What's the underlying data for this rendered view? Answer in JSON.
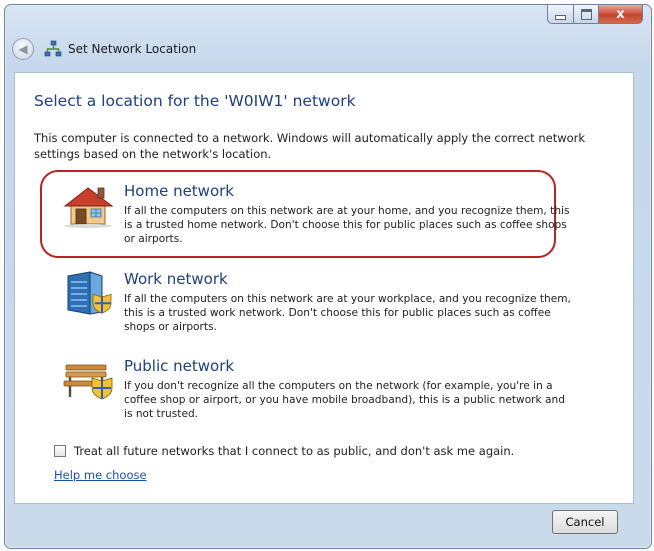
{
  "window": {
    "title": "Set Network Location",
    "close_glyph": "x"
  },
  "main": {
    "heading": "Select a location for the 'W0IW1' network",
    "intro": "This computer is connected to a network. Windows will automatically apply the correct network settings based on the network's location.",
    "options": [
      {
        "title": "Home network",
        "description": "If all the computers on this network are at your home, and you recognize them, this is a trusted home network. Don't choose this for public places such as coffee shops or airports.",
        "icon": "house-icon",
        "highlighted": true
      },
      {
        "title": "Work network",
        "description": "If all the computers on this network are at your workplace, and you recognize them, this is a trusted work network. Don't choose this for public places such as coffee shops or airports.",
        "icon": "office-building-icon",
        "highlighted": false
      },
      {
        "title": "Public network",
        "description": "If you don't recognize all the computers on the network (for example, you're in a coffee shop or airport, or you have mobile broadband), this is a public network and is not trusted.",
        "icon": "park-bench-icon",
        "highlighted": false
      }
    ],
    "checkbox_label": "Treat all future networks that I connect to as public, and don't ask me again.",
    "checkbox_checked": false,
    "help_link": "Help me choose"
  },
  "footer": {
    "cancel_label": "Cancel"
  },
  "colors": {
    "heading": "#1f3f7d",
    "link": "#1c4fb0",
    "highlight": "#b82323",
    "close_button": "#c8442f"
  }
}
